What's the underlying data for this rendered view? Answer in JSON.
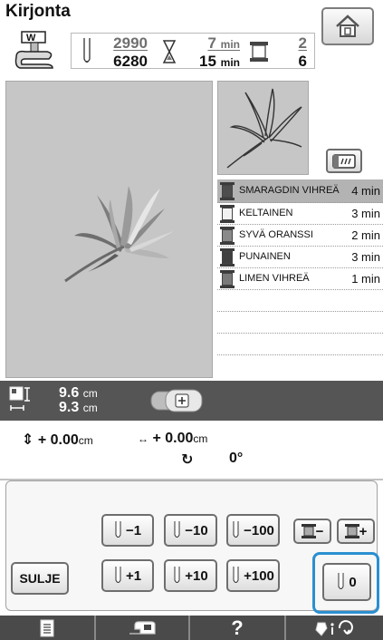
{
  "header": {
    "title": "Kirjonta",
    "home_icon": "home-icon"
  },
  "stitch_info": {
    "stitches_done": "2990",
    "stitches_total": "6280",
    "time_done": "7",
    "time_total": "15",
    "time_unit": "min",
    "colors_done": "2",
    "colors_total": "6"
  },
  "color_list": [
    {
      "name": "SMARAGDIN VIHREÄ",
      "time": "4 min",
      "color": "#4d4d4d",
      "selected": true
    },
    {
      "name": "KELTAINEN",
      "time": "3 min",
      "color": "#f2f2f2",
      "selected": false
    },
    {
      "name": "SYVÄ ORANSSI",
      "time": "2 min",
      "color": "#8a8a8a",
      "selected": false
    },
    {
      "name": "PUNAINEN",
      "time": "3 min",
      "color": "#3f3f3f",
      "selected": false
    },
    {
      "name": "LIMEN VIHREÄ",
      "time": "1 min",
      "color": "#7a7a7a",
      "selected": false
    }
  ],
  "size": {
    "width": "9.6",
    "height": "9.3",
    "unit": "cm"
  },
  "offset": {
    "x_sign": "+",
    "x": "0.00",
    "y_sign": "+",
    "y": "0.00",
    "unit": "cm"
  },
  "rotation": {
    "value": "0°"
  },
  "controls": {
    "close_label": "SULJE",
    "minus1": "−1",
    "minus10": "−10",
    "minus100": "−100",
    "plus1": "+1",
    "plus10": "+10",
    "plus100": "+100",
    "color_minus": "−",
    "color_plus": "+",
    "reset_label": "0"
  },
  "colors": {
    "accent": "#2a8fd0",
    "bar": "#555555",
    "preview_bg": "#c6c6c6"
  }
}
